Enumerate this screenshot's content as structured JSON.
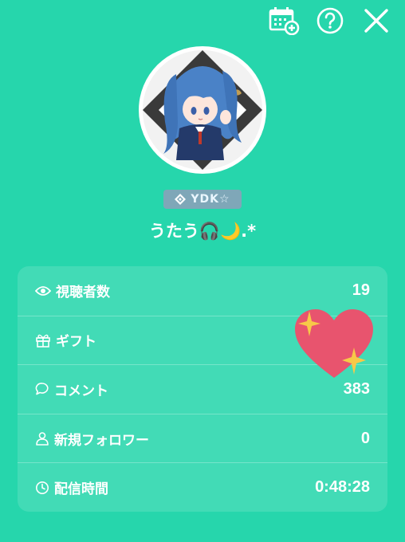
{
  "topbar": {
    "icons": [
      "calendar-add-icon",
      "help-icon",
      "close-icon"
    ]
  },
  "profile": {
    "badge_text": "YDK☆",
    "username": "うたう🎧🌙.*"
  },
  "stats": [
    {
      "icon": "eye-icon",
      "label": "視聴者数",
      "value": "19"
    },
    {
      "icon": "gift-icon",
      "label": "ギフト",
      "value": ""
    },
    {
      "icon": "comment-icon",
      "label": "コメント",
      "value": "383"
    },
    {
      "icon": "person-icon",
      "label": "新規フォロワー",
      "value": "0"
    },
    {
      "icon": "clock-icon",
      "label": "配信時間",
      "value": "0:48:28"
    }
  ],
  "colors": {
    "background": "#26d6ac",
    "heart": "#e8546e",
    "sparkle": "#f7c948",
    "badge": "#7fa7b8"
  }
}
